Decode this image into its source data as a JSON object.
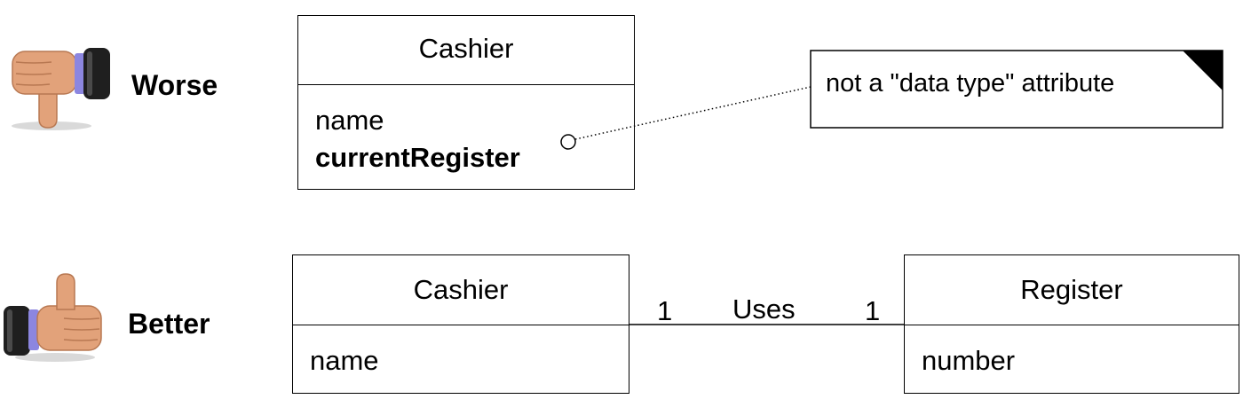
{
  "worse": {
    "label": "Worse",
    "icon": "thumbs-down-icon",
    "class_box": {
      "name": "Cashier",
      "attributes": [
        "name",
        "currentRegister"
      ]
    },
    "note": {
      "text": "not a \"data type\" attribute"
    }
  },
  "better": {
    "label": "Better",
    "icon": "thumbs-up-icon",
    "cashier_box": {
      "name": "Cashier",
      "attributes": [
        "name"
      ]
    },
    "register_box": {
      "name": "Register",
      "attributes": [
        "number"
      ]
    },
    "association": {
      "name": "Uses",
      "left_multiplicity": "1",
      "right_multiplicity": "1"
    }
  },
  "colors": {
    "skin": "#e2a27a",
    "skin_shadow": "#b87852",
    "sleeve": "#1f1f1f",
    "cuff": "#8c86e0",
    "line": "#000000"
  }
}
